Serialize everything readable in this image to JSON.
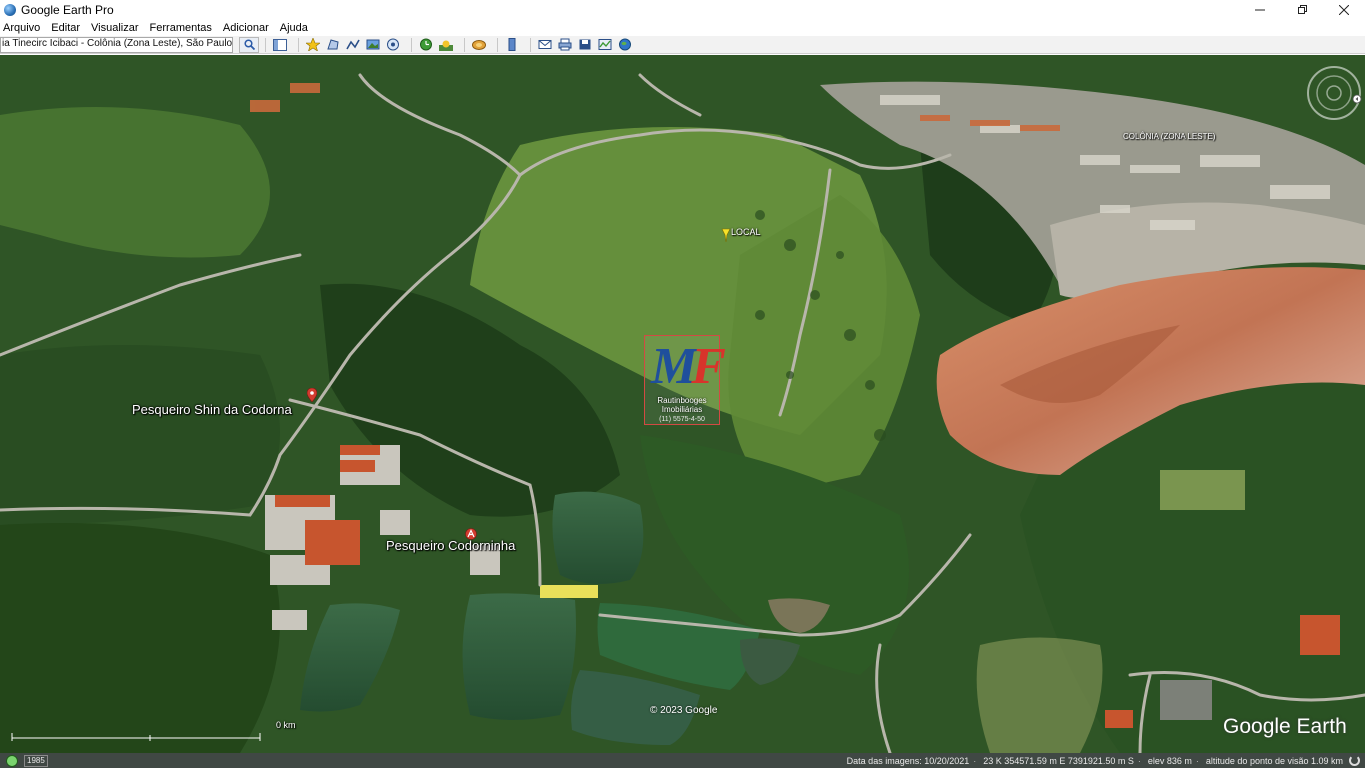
{
  "window": {
    "title": "Google Earth Pro"
  },
  "menu": [
    "Arquivo",
    "Editar",
    "Visualizar",
    "Ferramentas",
    "Adicionar",
    "Ajuda"
  ],
  "search": {
    "value": "ia Tinecirc Icibaci - Colônia (Zona Leste), São Paulo - SP"
  },
  "map": {
    "labels": {
      "local": "LOCAL",
      "pesqueiro_shin": "Pesqueiro Shin da Codorna",
      "pesqueiro_codorninha": "Pesqueiro Codorninha",
      "colonia": "COLÔNIA (ZONA LESTE)",
      "scale_unit": "0 km"
    },
    "watermark": {
      "letters_m": "M",
      "letters_f": "F",
      "subtitle": "Rautinbooges Imobiliárias",
      "phone": "(11) 5575-4-50"
    },
    "copyright": "© 2023 Google",
    "logo": "Google Earth"
  },
  "status": {
    "year": "1985",
    "image_date": "Data das imagens: 10/20/2021",
    "coordinates": "23 K 354571.59 m E 7391921.50 m S",
    "elevation": "elev 836 m",
    "eye_alt": "altitude do ponto de visão 1.09 km"
  },
  "colors": {
    "vegetation_dark": "#264a1e",
    "vegetation_light": "#5e8a35",
    "quarry": "#c8795a",
    "water": "#2f5d3c",
    "status_bg": "#0a140f"
  }
}
